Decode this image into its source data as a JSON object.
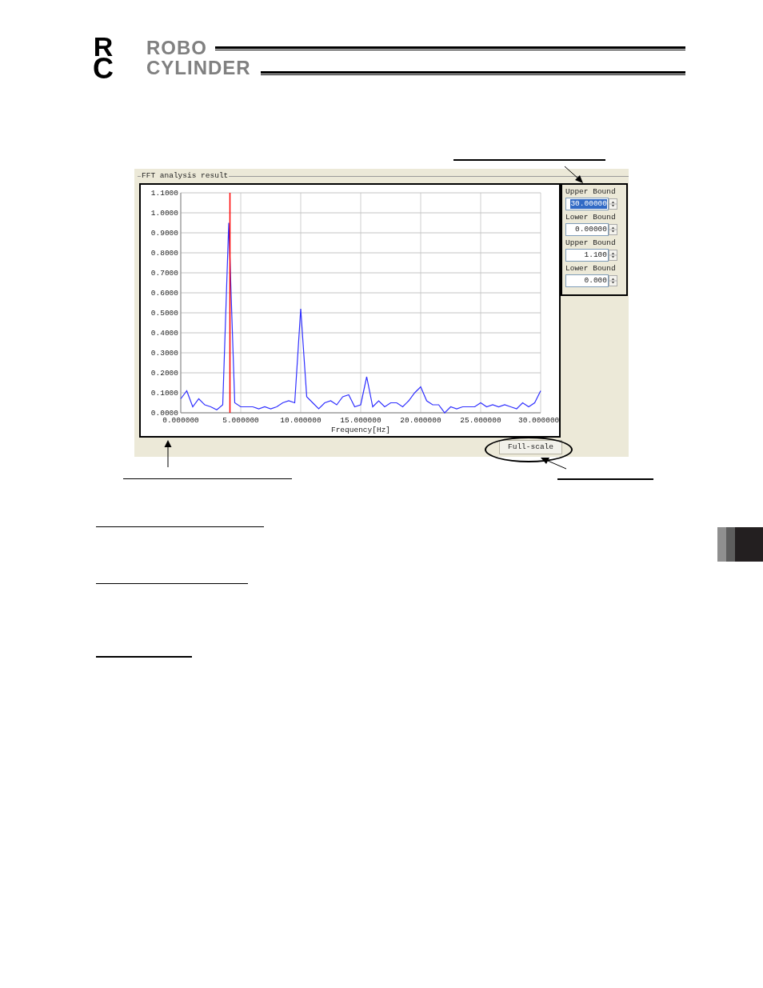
{
  "logo": {
    "mark_top": "R",
    "mark_bottom": "C",
    "line1": "ROBO",
    "line2": "CYLINDER"
  },
  "window": {
    "group_title": "FFT analysis result",
    "chart": {
      "chart_data": {
        "type": "line",
        "xlabel": "Frequency[Hz]",
        "xlim": [
          0,
          30
        ],
        "ylim": [
          0,
          1.1
        ],
        "x": [
          0,
          0.5,
          1,
          1.5,
          2,
          2.5,
          3,
          3.5,
          4,
          4.5,
          5,
          5.5,
          6,
          6.5,
          7,
          7.5,
          8,
          8.5,
          9,
          9.5,
          10,
          10.5,
          11,
          11.5,
          12,
          12.5,
          13,
          13.5,
          14,
          14.5,
          15,
          15.5,
          16,
          16.5,
          17,
          17.5,
          18,
          18.5,
          19,
          19.5,
          20,
          20.5,
          21,
          21.5,
          22,
          22.5,
          23,
          23.5,
          24,
          24.5,
          25,
          25.5,
          26,
          26.5,
          27,
          27.5,
          28,
          28.5,
          29,
          29.5,
          30
        ],
        "series": [
          {
            "color": "#3030ff",
            "values": [
              0.07,
              0.11,
              0.03,
              0.07,
              0.04,
              0.03,
              0.015,
              0.04,
              0.95,
              0.05,
              0.03,
              0.03,
              0.03,
              0.02,
              0.03,
              0.02,
              0.03,
              0.05,
              0.06,
              0.05,
              0.52,
              0.08,
              0.05,
              0.02,
              0.05,
              0.06,
              0.04,
              0.08,
              0.09,
              0.03,
              0.04,
              0.18,
              0.03,
              0.06,
              0.03,
              0.05,
              0.05,
              0.03,
              0.06,
              0.1,
              0.13,
              0.06,
              0.04,
              0.04,
              0.0,
              0.03,
              0.02,
              0.03,
              0.03,
              0.03,
              0.05,
              0.03,
              0.04,
              0.03,
              0.04,
              0.03,
              0.02,
              0.05,
              0.03,
              0.05,
              0.11
            ]
          }
        ],
        "xticks": [
          {
            "value": 0,
            "label": "0.000000"
          },
          {
            "value": 5,
            "label": "5.000000"
          },
          {
            "value": 10,
            "label": "10.000000"
          },
          {
            "value": 15,
            "label": "15.000000"
          },
          {
            "value": 20,
            "label": "20.000000"
          },
          {
            "value": 25,
            "label": "25.000000"
          },
          {
            "value": 30,
            "label": "30.000000"
          }
        ],
        "yticks": [
          {
            "value": 0,
            "label": "0.0000"
          },
          {
            "value": 0.1,
            "label": "0.1000"
          },
          {
            "value": 0.2,
            "label": "0.2000"
          },
          {
            "value": 0.3,
            "label": "0.3000"
          },
          {
            "value": 0.4,
            "label": "0.4000"
          },
          {
            "value": 0.5,
            "label": "0.5000"
          },
          {
            "value": 0.6,
            "label": "0.6000"
          },
          {
            "value": 0.7,
            "label": "0.7000"
          },
          {
            "value": 0.8,
            "label": "0.8000"
          },
          {
            "value": 0.9,
            "label": "0.9000"
          },
          {
            "value": 1.0,
            "label": "1.0000"
          },
          {
            "value": 1.1,
            "label": "1.1000"
          }
        ],
        "grid": true,
        "ref_lines": [
          {
            "axis": "x",
            "value": 4.1,
            "color": "#ff0000"
          }
        ]
      }
    },
    "bounds": [
      {
        "label": "Upper Bound",
        "value": "30.00000",
        "selected": true
      },
      {
        "label": "Lower Bound",
        "value": "0.00000",
        "selected": false
      },
      {
        "label": "Upper Bound",
        "value": "1.100",
        "selected": false
      },
      {
        "label": "Lower Bound",
        "value": "0.000",
        "selected": false
      }
    ],
    "full_scale_button": "Full-scale"
  }
}
